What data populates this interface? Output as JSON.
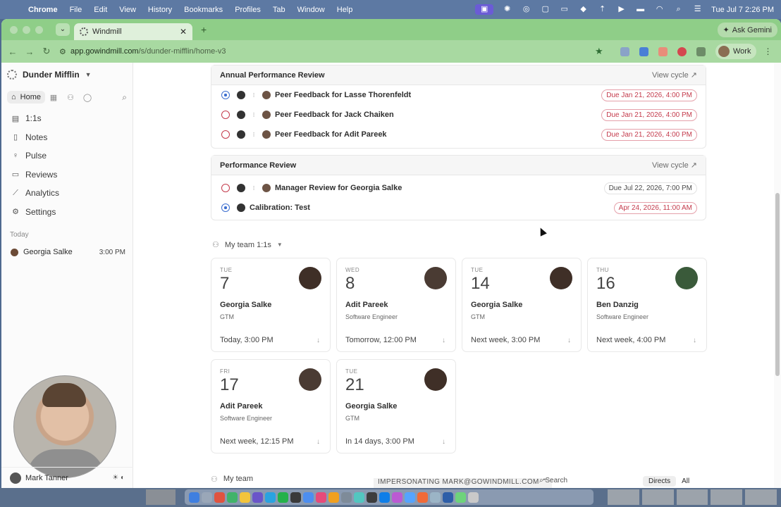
{
  "menubar": {
    "app": "Chrome",
    "items": [
      "File",
      "Edit",
      "View",
      "History",
      "Bookmarks",
      "Profiles",
      "Tab",
      "Window",
      "Help"
    ],
    "clock": "Tue Jul 7  2:26 PM"
  },
  "browser": {
    "tab_title": "Windmill",
    "ask_gemini": "Ask Gemini",
    "url_host": "app.gowindmill.com",
    "url_path": "/s/dunder-mifflin/home-v3",
    "profile": "Work"
  },
  "sidebar": {
    "org": "Dunder Mifflin",
    "home": "Home",
    "items": [
      {
        "label": "1:1s",
        "icon": "calendar-icon"
      },
      {
        "label": "Notes",
        "icon": "notes-icon"
      },
      {
        "label": "Pulse",
        "icon": "pulse-icon"
      },
      {
        "label": "Reviews",
        "icon": "reviews-icon"
      },
      {
        "label": "Analytics",
        "icon": "analytics-icon"
      },
      {
        "label": "Settings",
        "icon": "gear-icon"
      }
    ],
    "today_label": "Today",
    "today": {
      "name": "Georgia Salke",
      "time": "3:00 PM"
    },
    "user": "Mark Tanner"
  },
  "reviews": {
    "annual": {
      "title": "Annual Performance Review",
      "view": "View cycle ↗",
      "rows": [
        {
          "title": "Peer Feedback for Lasse Thorenfeldt",
          "due": "Due Jan 21, 2026, 4:00 PM",
          "state": "progress",
          "overdue": true
        },
        {
          "title": "Peer Feedback for Jack Chaiken",
          "due": "Due Jan 21, 2026, 4:00 PM",
          "state": "todo",
          "overdue": true
        },
        {
          "title": "Peer Feedback for Adit Pareek",
          "due": "Due Jan 21, 2026, 4:00 PM",
          "state": "todo",
          "overdue": true
        }
      ]
    },
    "performance": {
      "title": "Performance Review",
      "view": "View cycle ↗",
      "rows": [
        {
          "title": "Manager Review for Georgia Salke",
          "due": "Due Jul 22, 2026, 7:00 PM",
          "state": "todo",
          "overdue": false
        },
        {
          "title": "Calibration: Test",
          "due": "Apr 24, 2026, 11:00 AM",
          "state": "progress",
          "overdue": true
        }
      ]
    }
  },
  "team_ones": {
    "heading": "My team 1:1s",
    "meetings": [
      {
        "dow": "TUE",
        "day": "7",
        "name": "Georgia Salke",
        "role": "GTM",
        "when": "Today, 3:00 PM"
      },
      {
        "dow": "WED",
        "day": "8",
        "name": "Adit Pareek",
        "role": "Software Engineer",
        "when": "Tomorrow, 12:00 PM"
      },
      {
        "dow": "TUE",
        "day": "14",
        "name": "Georgia Salke",
        "role": "GTM",
        "when": "Next week, 3:00 PM"
      },
      {
        "dow": "THU",
        "day": "16",
        "name": "Ben Danzig",
        "role": "Software Engineer",
        "when": "Next week, 4:00 PM"
      },
      {
        "dow": "FRI",
        "day": "17",
        "name": "Adit Pareek",
        "role": "Software Engineer",
        "when": "Next week, 12:15 PM"
      },
      {
        "dow": "TUE",
        "day": "21",
        "name": "Georgia Salke",
        "role": "GTM",
        "when": "In 14 days, 3:00 PM"
      }
    ]
  },
  "bottom": {
    "my_team": "My team",
    "impersonating": "IMPERSONATING MARK@GOWINDMILL.COM ⌃",
    "search": "Search",
    "directs": "Directs",
    "all": "All"
  }
}
